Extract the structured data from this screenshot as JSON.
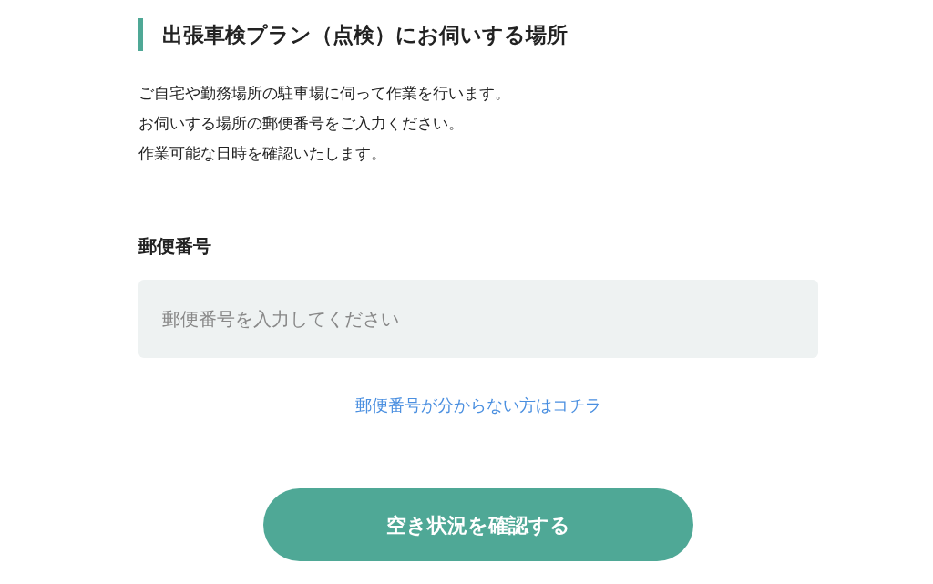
{
  "heading": "出張車検プラン（点検）にお伺いする場所",
  "description": [
    "ご自宅や勤務場所の駐車場に伺って作業を行います。",
    "お伺いする場所の郵便番号をご入力ください。",
    "作業可能な日時を確認いたします。"
  ],
  "postal_code": {
    "label": "郵便番号",
    "placeholder": "郵便番号を入力してください"
  },
  "help_link": "郵便番号が分からない方はコチラ",
  "submit_button": "空き状況を確認する"
}
